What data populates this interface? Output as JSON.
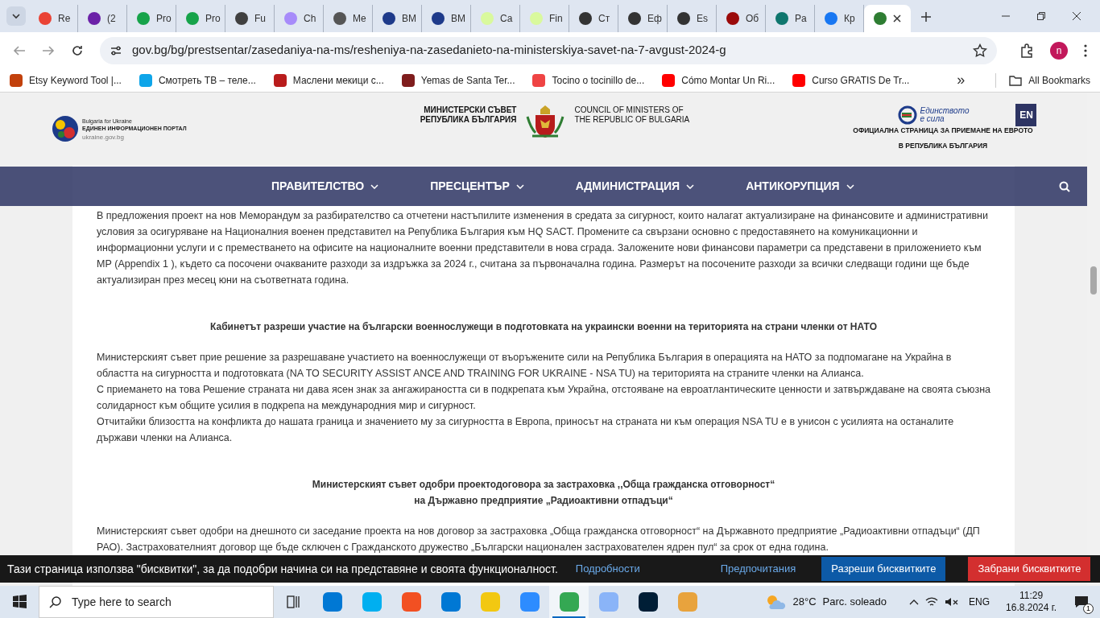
{
  "browser": {
    "tabs": [
      {
        "label": "Re",
        "color": "#ea4335",
        "selected": false
      },
      {
        "label": "(2",
        "color": "#6b21a8",
        "selected": false
      },
      {
        "label": "Pro",
        "color": "#16a34a",
        "selected": false
      },
      {
        "label": "Pro",
        "color": "#16a34a",
        "selected": false
      },
      {
        "label": "Fu",
        "color": "#404040",
        "selected": false
      },
      {
        "label": "Ch",
        "color": "#a78bfa",
        "selected": false
      },
      {
        "label": "Me",
        "color": "#555555",
        "selected": false
      },
      {
        "label": "BM",
        "color": "#1e3a8a",
        "selected": false
      },
      {
        "label": "BM",
        "color": "#1e3a8a",
        "selected": false
      },
      {
        "label": "Ca",
        "color": "#d9f99d",
        "selected": false
      },
      {
        "label": "Fin",
        "color": "#d9f99d",
        "selected": false
      },
      {
        "label": "Ст",
        "color": "#333333",
        "selected": false
      },
      {
        "label": "Еф",
        "color": "#333333",
        "selected": false
      },
      {
        "label": "Es",
        "color": "#333333",
        "selected": false
      },
      {
        "label": "Об",
        "color": "#9b0a0a",
        "selected": false
      },
      {
        "label": "Pa",
        "color": "#0f766e",
        "selected": false
      },
      {
        "label": "Кр",
        "color": "#1877f2",
        "selected": false
      },
      {
        "color": "#2e7d32",
        "selected": true
      }
    ],
    "url": "gov.bg/bg/prestsentar/zasedaniya-na-ms/resheniya-na-zasedanieto-na-ministerskiya-savet-na-7-avgust-2024-g",
    "profile": "n",
    "bookmarks": [
      {
        "label": "Etsy Keyword Tool |...",
        "color": "#c2410c"
      },
      {
        "label": "Смотреть ТВ – теле...",
        "color": "#0ea5e9"
      },
      {
        "label": "Маслени мекици с...",
        "color": "#b91c1c"
      },
      {
        "label": "Yemas de Santa Ter...",
        "color": "#7f1d1d"
      },
      {
        "label": "Tocino o tocinillo de...",
        "color": "#ef4444"
      },
      {
        "label": "Cómo Montar Un Ri...",
        "color": "#ff0000"
      },
      {
        "label": "Curso GRATIS De Tr...",
        "color": "#ff0000"
      }
    ],
    "more_bookmarks": "»",
    "all_bookmarks": "All Bookmarks"
  },
  "header": {
    "left_logo": {
      "line_1": "Bulgaria for Ukraine",
      "line_2": "ЕДИНЕН ИНФОРМАЦИОНЕН ПОРТАЛ",
      "line_3": "ukraine.gov.bg"
    },
    "center_bg": [
      "МИНИСТЕРСКИ СЪВЕТ",
      "РЕПУБЛИКА БЪЛГАРИЯ"
    ],
    "center_en": [
      "COUNCIL OF MINISTERS OF",
      "THE REPUBLIC OF BULGARIA"
    ],
    "euro_logo": [
      "Единството",
      "е сила"
    ],
    "language_button": "EN",
    "euro_caption": "ОФИЦИАЛНА СТРАНИЦА ЗА ПРИЕМАНЕ НА ЕВРОТО В РЕПУБЛИКА БЪЛГАРИЯ"
  },
  "nav": {
    "items": [
      "ПРАВИТЕЛСТВО",
      "ПРЕСЦЕНТЪР",
      "АДМИНИСТРАЦИЯ",
      "АНТИКОРУПЦИЯ"
    ]
  },
  "content": [
    {
      "kind": "text",
      "text": "В предложения проект на нов Меморандум за разбирателство са отчетени настъпилите изменения в средата за сигурност, които налагат актуализиране на финансовите и административни условия за осигуряване на Националния военен представител на Република България към HQ SACT. Промените са свързани основно с предоставянето на комуникационни и информационни услуги и с преместването на офисите на националните военни представители в нова сграда. Заложените нови финансови параметри са представени в приложението към МР (Appendix 1 ), където са посочени очакваните разходи за издръжка за 2024 г., считана за първоначална година. Размерът на посочените разходи за всички следващи години ще бъде актуализиран през месец юни на съответната година."
    },
    {
      "kind": "heading",
      "lines": [
        "Кабинетът разреши участие на български военнослужещи в подготовката на украински военни на територията на страни членки от НАТО"
      ]
    },
    {
      "kind": "text",
      "text": "Министерският съвет прие решение за разрешаване участието на военнослужещи от въоръжените сили на Република България в операцията на НАТО за подпомагане на Украйна в областта на сигурността и подготовката (NA TO SECURITY ASSIST ANCE AND TRAINING FOR UKRAINE - NSA TU) на територията на страните членки на Алианса."
    },
    {
      "kind": "text",
      "text": "С приемането на това Решение страната ни дава ясен знак за ангажираността си в подкрепата към Украйна, отстояване на евроатлантическите ценности и затвърждаване на своята съюзна солидарност към общите усилия в подкрепа на международния мир и сигурност."
    },
    {
      "kind": "text",
      "text": "Отчитайки близостта на конфликта до нашата граница и значението му за сигурността в Европа, приносът на страната ни към операция NSA TU е в унисон с усилията на останалите държави членки на Алианса."
    },
    {
      "kind": "heading",
      "lines": [
        "Министерският съвет одобри проектодоговора за застраховка ,,Обща гражданска отговорност“",
        "на Държавно предприятие „Радиоактивни отпадъци“"
      ]
    },
    {
      "kind": "text",
      "text": "Министерският съвет одобри на днешното си заседание проекта на нов договор за застраховка „Обща гражданска отговорност“ на Държавното предприятие „Радиоактивни отпадъци“ (ДП РАО). Застрахователният договор ще бъде сключен с Гражданското дружество „Български национален застрахователен ядрен пул“ за срок от една година."
    }
  ],
  "cookie_bar": {
    "message": "Тази страница използва \"бисквитки\", за да подобри начина си на представяне и своята функционалност.",
    "details_link": "Подробности",
    "preferences_link": "Предпочитания",
    "buttons": [
      {
        "label": "Разреши бисквитките",
        "kind": "allow"
      },
      {
        "label": "Забрани бисквитките",
        "kind": "deny"
      }
    ]
  },
  "taskbar": {
    "search_placeholder": "Type here to search",
    "apps": [
      {
        "color": "#0078d4",
        "selected": false
      },
      {
        "color": "#00aff0",
        "selected": false
      },
      {
        "color": "#f25022",
        "selected": false
      },
      {
        "color": "#0078d4",
        "selected": false
      },
      {
        "color": "#f2c811",
        "selected": false
      },
      {
        "color": "#2d8cff",
        "selected": false
      },
      {
        "color": "#34a853",
        "selected": true
      },
      {
        "color": "#8ab4f8",
        "selected": false
      },
      {
        "color": "#001e36",
        "selected": false
      },
      {
        "color": "#e8a33d",
        "selected": false
      }
    ],
    "weather": "28°C",
    "weather_text": "Parc. soleado",
    "language": "ENG",
    "time": "11:29",
    "date": "16.8.2024 г.",
    "notifications": "1"
  }
}
